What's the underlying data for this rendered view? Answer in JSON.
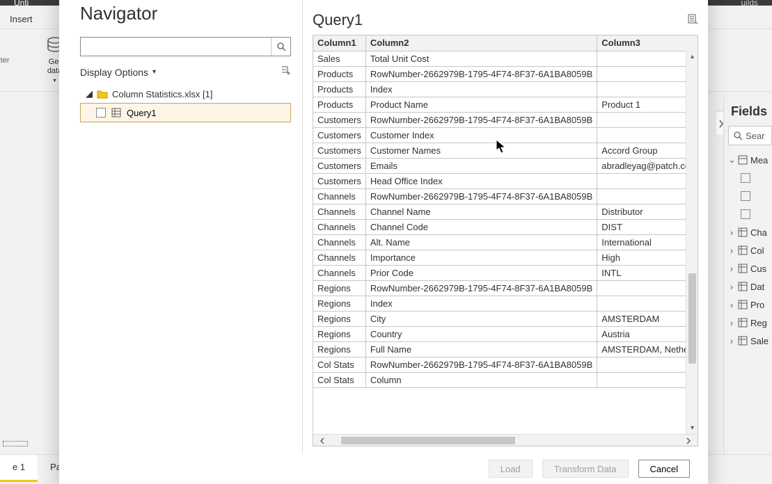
{
  "app": {
    "doc_title": "Unti",
    "right_hint": "uilds"
  },
  "ribbon": {
    "tab_insert": "Insert",
    "get_data_line1": "Get",
    "get_data_line2": "data",
    "painter": "ainter"
  },
  "nav": {
    "title": "Navigator",
    "display_label": "Display Options",
    "file_label": "Column Statistics.xlsx [1]",
    "query_item": "Query1"
  },
  "preview": {
    "title": "Query1",
    "columns": [
      "Column1",
      "Column2",
      "Column3"
    ],
    "rows": [
      [
        "Sales",
        "Total Unit Cost",
        ""
      ],
      [
        "Products",
        "RowNumber-2662979B-1795-4F74-8F37-6A1BA8059B",
        ""
      ],
      [
        "Products",
        "Index",
        ""
      ],
      [
        "Products",
        "Product Name",
        "Product 1"
      ],
      [
        "Customers",
        "RowNumber-2662979B-1795-4F74-8F37-6A1BA8059B",
        ""
      ],
      [
        "Customers",
        "Customer Index",
        ""
      ],
      [
        "Customers",
        "Customer Names",
        "Accord Group"
      ],
      [
        "Customers",
        "Emails",
        "abradleyag@patch.com"
      ],
      [
        "Customers",
        "Head Office Index",
        ""
      ],
      [
        "Channels",
        "RowNumber-2662979B-1795-4F74-8F37-6A1BA8059B",
        ""
      ],
      [
        "Channels",
        "Channel Name",
        "Distributor"
      ],
      [
        "Channels",
        "Channel Code",
        "DIST"
      ],
      [
        "Channels",
        "Alt. Name",
        "International"
      ],
      [
        "Channels",
        "Importance",
        "High"
      ],
      [
        "Channels",
        "Prior Code",
        "INTL"
      ],
      [
        "Regions",
        "RowNumber-2662979B-1795-4F74-8F37-6A1BA8059B",
        ""
      ],
      [
        "Regions",
        "Index",
        ""
      ],
      [
        "Regions",
        "City",
        "AMSTERDAM"
      ],
      [
        "Regions",
        "Country",
        "Austria"
      ],
      [
        "Regions",
        "Full Name",
        "AMSTERDAM, Netherl"
      ],
      [
        "Col Stats",
        "RowNumber-2662979B-1795-4F74-8F37-6A1BA8059B",
        ""
      ],
      [
        "Col Stats",
        "Column",
        ""
      ]
    ]
  },
  "footer": {
    "load": "Load",
    "transform": "Transform Data",
    "cancel": "Cancel"
  },
  "fields": {
    "title": "Fields",
    "search_placeholder": "Sear",
    "items": [
      "Mea",
      "",
      "",
      "",
      "Cha",
      "Col",
      "Cus",
      "Dat",
      "Pro",
      "Reg",
      "Sale"
    ]
  },
  "pages": {
    "p1": "e 1",
    "p2": "Pag"
  }
}
